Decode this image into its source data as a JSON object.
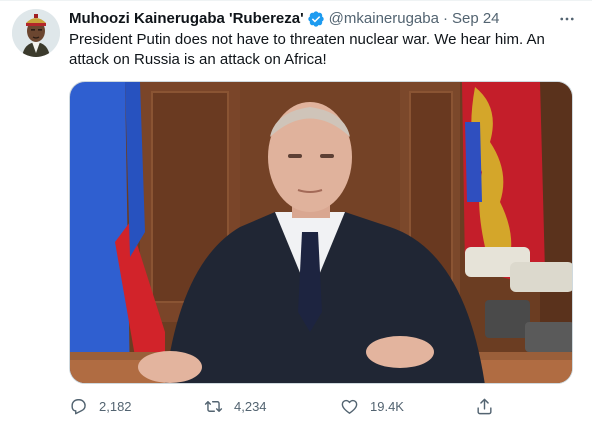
{
  "tweet": {
    "author_name": "Muhoozi Kainerugaba 'Rubereza'",
    "handle": "@mkainerugaba",
    "separator": "·",
    "date": "Sep 24",
    "text": "President Putin does not have to threaten nuclear war. We hear him. An attack on Russia is an attack on Africa!",
    "verified": true,
    "media_subject": "Vladimir Putin seated at desk with Russian flag and telephones"
  },
  "actions": {
    "replies": "2,182",
    "retweets": "4,234",
    "likes": "19.4K"
  },
  "icons": {
    "verified": "verified-badge-icon",
    "more": "more-icon",
    "reply": "reply-icon",
    "retweet": "retweet-icon",
    "like": "like-icon",
    "share": "share-icon"
  },
  "colors": {
    "text_primary": "#0f1419",
    "text_secondary": "#536471",
    "verified_blue": "#1d9bf0",
    "border": "#cfd9de"
  }
}
